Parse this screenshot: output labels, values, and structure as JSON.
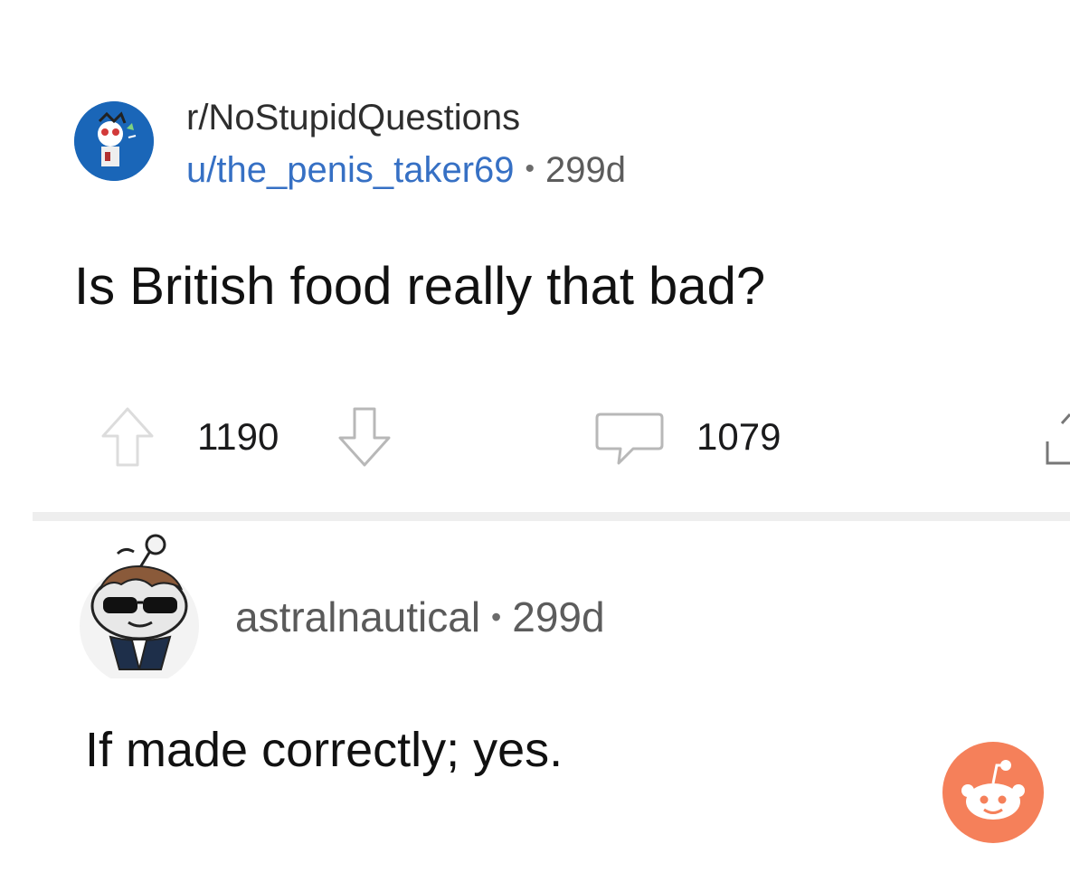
{
  "post": {
    "subreddit": "r/NoStupidQuestions",
    "author": "u/the_penis_taker69",
    "separator": "•",
    "age": "299d",
    "title": "Is British food really that bad?",
    "upvotes": "1190",
    "comments": "1079"
  },
  "comment": {
    "author": "astralnautical",
    "separator": "•",
    "age": "299d",
    "body": "If made correctly; yes."
  },
  "icons": {
    "subreddit_avatar": "subreddit-avatar-icon",
    "upvote": "upvote-arrow-icon",
    "downvote": "downvote-arrow-icon",
    "comments": "comment-bubble-icon",
    "share": "share-icon",
    "commenter_avatar": "snoo-avatar-icon",
    "reddit_logo": "reddit-logo-icon"
  },
  "colors": {
    "username_link": "#3670c4",
    "subreddit_avatar_bg": "#1a66b8",
    "reddit_orange": "#ff4500",
    "icon_gray": "#b8b8b8",
    "divider": "#eeeeee"
  }
}
